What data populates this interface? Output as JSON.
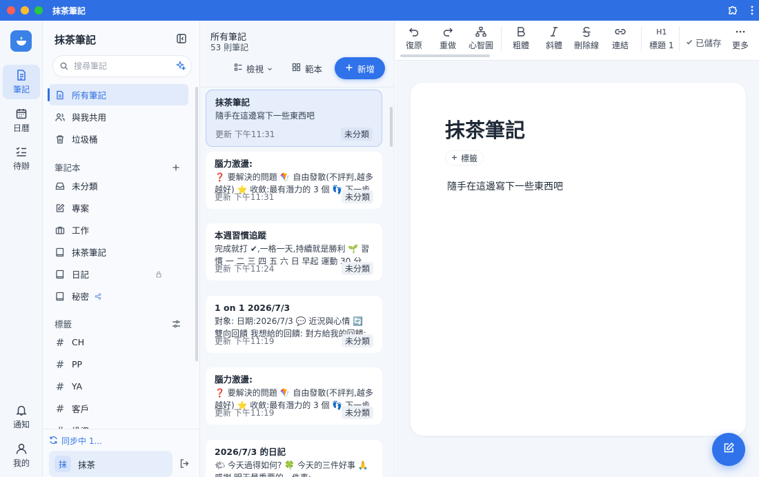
{
  "window": {
    "title": "抹茶筆記"
  },
  "rail": {
    "items": [
      {
        "label": "筆記",
        "icon": "note-icon",
        "active": true
      },
      {
        "label": "日曆",
        "icon": "calendar-icon"
      },
      {
        "label": "待辦",
        "icon": "checklist-icon"
      }
    ],
    "bottom": [
      {
        "label": "通知",
        "icon": "bell-icon"
      },
      {
        "label": "我的",
        "icon": "person-icon"
      }
    ]
  },
  "sidebar": {
    "title": "抹茶筆記",
    "search_placeholder": "搜尋筆記",
    "main_items": [
      {
        "label": "所有筆記",
        "icon": "document-icon",
        "active": true
      },
      {
        "label": "與我共用",
        "icon": "people-icon"
      },
      {
        "label": "垃圾桶",
        "icon": "trash-icon"
      }
    ],
    "notebooks_label": "筆記本",
    "notebooks": [
      {
        "label": "未分類",
        "icon": "inbox-icon"
      },
      {
        "label": "專案",
        "icon": "edit-note-icon"
      },
      {
        "label": "工作",
        "icon": "briefcase-icon"
      },
      {
        "label": "抹茶筆記",
        "icon": "notebook-icon"
      },
      {
        "label": "日記",
        "icon": "notebook-icon",
        "trail": "lock-icon"
      },
      {
        "label": "秘密",
        "icon": "notebook-icon",
        "trail": "share-icon"
      }
    ],
    "tags_label": "標籤",
    "tags": [
      "CH",
      "PP",
      "YA",
      "客戶",
      "投資"
    ],
    "sync_status": "同步中 1...",
    "user": {
      "avatar": "抹",
      "name": "抹茶"
    }
  },
  "note_list": {
    "title": "所有筆記",
    "count": "53 則筆記",
    "view_label": "檢視",
    "template_label": "範本",
    "new_label": "新增",
    "cards": [
      {
        "title": "抹茶筆記",
        "body": "隨手在這邊寫下一些東西吧",
        "time": "更新 下午11:31",
        "tag": "未分類",
        "active": true
      },
      {
        "title": "腦力激盪:",
        "body": "❓ 要解決的問題 🪁 自由發散(不評判,越多越好) ⭐ 收斂:最有潛力的 3 個 👣 下一步",
        "time": "更新 下午11:31",
        "tag": "未分類"
      },
      {
        "title": "本週習慣追蹤",
        "body": "完成就打 ✔,一格一天,持續就是勝利 🌱 習慣 一 二 三 四 五 六 日 早起 運動 30 分鐘...",
        "time": "更新 下午11:24",
        "tag": "未分類"
      },
      {
        "title": "1 on 1 2026/7/3",
        "body": "對象: 日期:2026/7/3 💬 近況與心情 🔄 雙向回饋 我想給的回饋: 對方給我的回饋: ...",
        "time": "更新 下午11:19",
        "tag": "未分類"
      },
      {
        "title": "腦力激盪:",
        "body": "❓ 要解決的問題 🪁 自由發散(不評判,越多越好) ⭐ 收斂:最有潛力的 3 個 👣 下一步",
        "time": "更新 下午11:19",
        "tag": "未分類"
      },
      {
        "title": "2026/7/3 的日記",
        "body": "🌤 今天過得如何? 🍀 今天的三件好事 🙏 感謝 明天最重要的一件事:",
        "time": "",
        "tag": ""
      }
    ]
  },
  "toolbar": {
    "tools": [
      {
        "label": "復原",
        "icon": "undo-icon"
      },
      {
        "label": "重做",
        "icon": "redo-icon"
      },
      {
        "label": "心智圖",
        "icon": "mindmap-icon"
      },
      {
        "label": "粗體",
        "icon": "bold-icon"
      },
      {
        "label": "斜體",
        "icon": "italic-icon"
      },
      {
        "label": "刪除線",
        "icon": "strikethrough-icon"
      },
      {
        "label": "連結",
        "icon": "link-icon"
      },
      {
        "label": "標題 1",
        "icon": "heading-icon",
        "glyph": "H1"
      },
      {
        "label": "更多",
        "icon": "more-icon"
      }
    ],
    "saved_label": "已儲存"
  },
  "editor": {
    "title": "抹茶筆記",
    "tag_button": "標籤",
    "body": "隨手在這邊寫下一些東西吧"
  },
  "colors": {
    "accent": "#2f6fe4",
    "titlebar": "#2f6fe4"
  }
}
